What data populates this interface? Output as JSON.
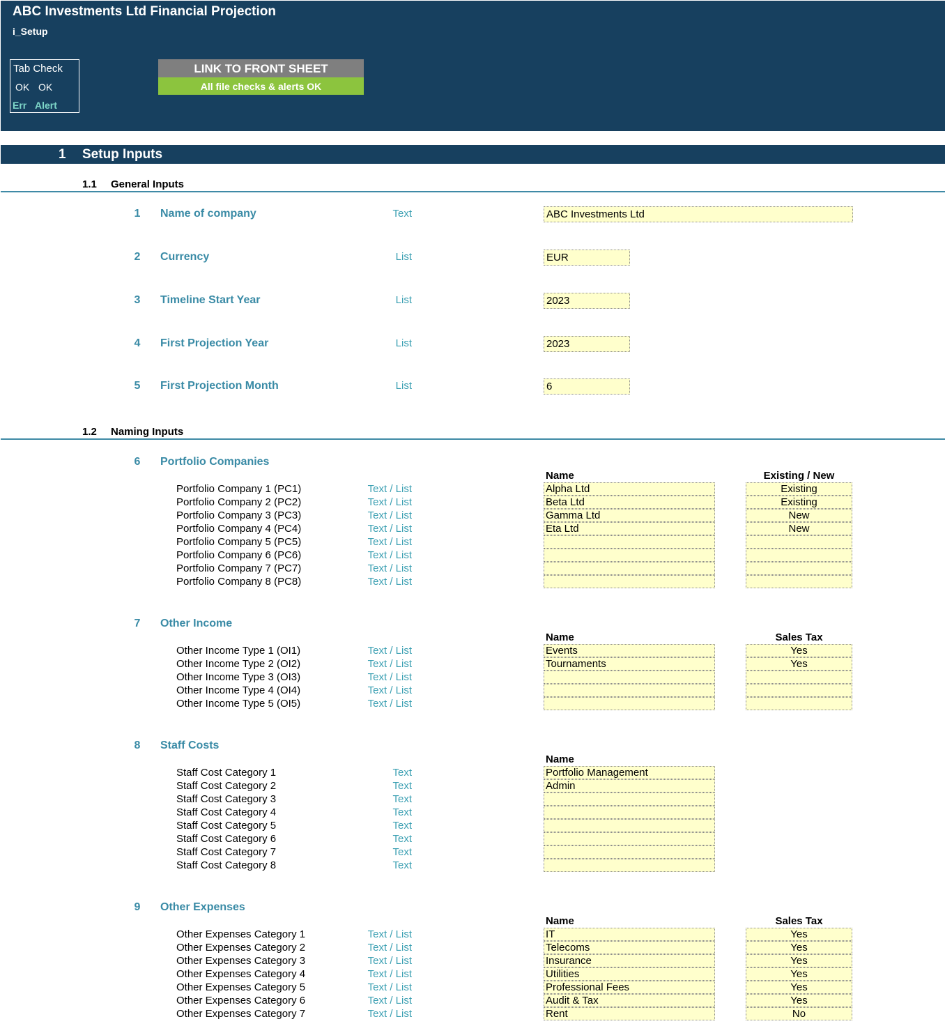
{
  "header": {
    "title": "ABC Investments Ltd Financial Projection",
    "sheet": "i_Setup",
    "tab_check": {
      "title": "Tab Check",
      "ok1": "OK",
      "ok2": "OK",
      "err": "Err",
      "alert": "Alert"
    },
    "link_button": "LINK TO FRONT SHEET",
    "checks_status": "All file checks & alerts OK"
  },
  "section": {
    "number": "1",
    "title": "Setup Inputs"
  },
  "general": {
    "number": "1.1",
    "title": "General Inputs",
    "items": [
      {
        "num": "1",
        "label": "Name of company",
        "type": "Text",
        "value": "ABC Investments Ltd"
      },
      {
        "num": "2",
        "label": "Currency",
        "type": "List",
        "value": "EUR"
      },
      {
        "num": "3",
        "label": "Timeline Start Year",
        "type": "List",
        "value": "2023"
      },
      {
        "num": "4",
        "label": "First Projection Year",
        "type": "List",
        "value": "2023"
      },
      {
        "num": "5",
        "label": "First Projection Month",
        "type": "List",
        "value": "6"
      }
    ]
  },
  "naming": {
    "number": "1.2",
    "title": "Naming Inputs",
    "groups": [
      {
        "num": "6",
        "title": "Portfolio Companies",
        "head_name": "Name",
        "head_flag": "Existing / New",
        "rows": [
          {
            "label": "Portfolio Company 1 (PC1)",
            "type": "Text / List",
            "name": "Alpha Ltd",
            "flag": "Existing"
          },
          {
            "label": "Portfolio Company 2 (PC2)",
            "type": "Text / List",
            "name": "Beta Ltd",
            "flag": "Existing"
          },
          {
            "label": "Portfolio Company 3 (PC3)",
            "type": "Text / List",
            "name": "Gamma Ltd",
            "flag": "New"
          },
          {
            "label": "Portfolio Company 4 (PC4)",
            "type": "Text / List",
            "name": "Eta Ltd",
            "flag": "New"
          },
          {
            "label": "Portfolio Company 5 (PC5)",
            "type": "Text / List",
            "name": "",
            "flag": ""
          },
          {
            "label": "Portfolio Company 6 (PC6)",
            "type": "Text / List",
            "name": "",
            "flag": ""
          },
          {
            "label": "Portfolio Company 7 (PC7)",
            "type": "Text / List",
            "name": "",
            "flag": ""
          },
          {
            "label": "Portfolio Company 8 (PC8)",
            "type": "Text / List",
            "name": "",
            "flag": ""
          }
        ]
      },
      {
        "num": "7",
        "title": "Other Income",
        "head_name": "Name",
        "head_flag": "Sales Tax",
        "rows": [
          {
            "label": "Other Income Type 1 (OI1)",
            "type": "Text / List",
            "name": "Events",
            "flag": "Yes"
          },
          {
            "label": "Other Income Type 2 (OI2)",
            "type": "Text / List",
            "name": "Tournaments",
            "flag": "Yes"
          },
          {
            "label": "Other Income Type 3 (OI3)",
            "type": "Text / List",
            "name": "",
            "flag": ""
          },
          {
            "label": "Other Income Type 4 (OI4)",
            "type": "Text / List",
            "name": "",
            "flag": ""
          },
          {
            "label": "Other Income Type 5 (OI5)",
            "type": "Text / List",
            "name": "",
            "flag": ""
          }
        ]
      },
      {
        "num": "8",
        "title": "Staff Costs",
        "head_name": "Name",
        "rows": [
          {
            "label": "Staff Cost Category 1",
            "type": "Text",
            "name": "Portfolio Management"
          },
          {
            "label": "Staff Cost Category 2",
            "type": "Text",
            "name": "Admin"
          },
          {
            "label": "Staff Cost Category 3",
            "type": "Text",
            "name": ""
          },
          {
            "label": "Staff Cost Category 4",
            "type": "Text",
            "name": ""
          },
          {
            "label": "Staff Cost Category 5",
            "type": "Text",
            "name": ""
          },
          {
            "label": "Staff Cost Category 6",
            "type": "Text",
            "name": ""
          },
          {
            "label": "Staff Cost Category 7",
            "type": "Text",
            "name": ""
          },
          {
            "label": "Staff Cost Category 8",
            "type": "Text",
            "name": ""
          }
        ]
      },
      {
        "num": "9",
        "title": "Other Expenses",
        "head_name": "Name",
        "head_flag": "Sales Tax",
        "rows": [
          {
            "label": "Other Expenses Category 1",
            "type": "Text / List",
            "name": "IT",
            "flag": "Yes"
          },
          {
            "label": "Other Expenses Category 2",
            "type": "Text / List",
            "name": "Telecoms",
            "flag": "Yes"
          },
          {
            "label": "Other Expenses Category 3",
            "type": "Text / List",
            "name": "Insurance",
            "flag": "Yes"
          },
          {
            "label": "Other Expenses Category 4",
            "type": "Text / List",
            "name": "Utilities",
            "flag": "Yes"
          },
          {
            "label": "Other Expenses Category 5",
            "type": "Text / List",
            "name": "Professional Fees",
            "flag": "Yes"
          },
          {
            "label": "Other Expenses Category 6",
            "type": "Text / List",
            "name": "Audit & Tax",
            "flag": "Yes"
          },
          {
            "label": "Other Expenses Category 7",
            "type": "Text / List",
            "name": "Rent",
            "flag": "No"
          }
        ]
      }
    ]
  },
  "colors": {
    "header_bg": "#17405f",
    "accent": "#3a8ba6",
    "input_bg": "#ffffcc",
    "button_gray": "#7f7f7f",
    "ok_green": "#8cc43e"
  }
}
